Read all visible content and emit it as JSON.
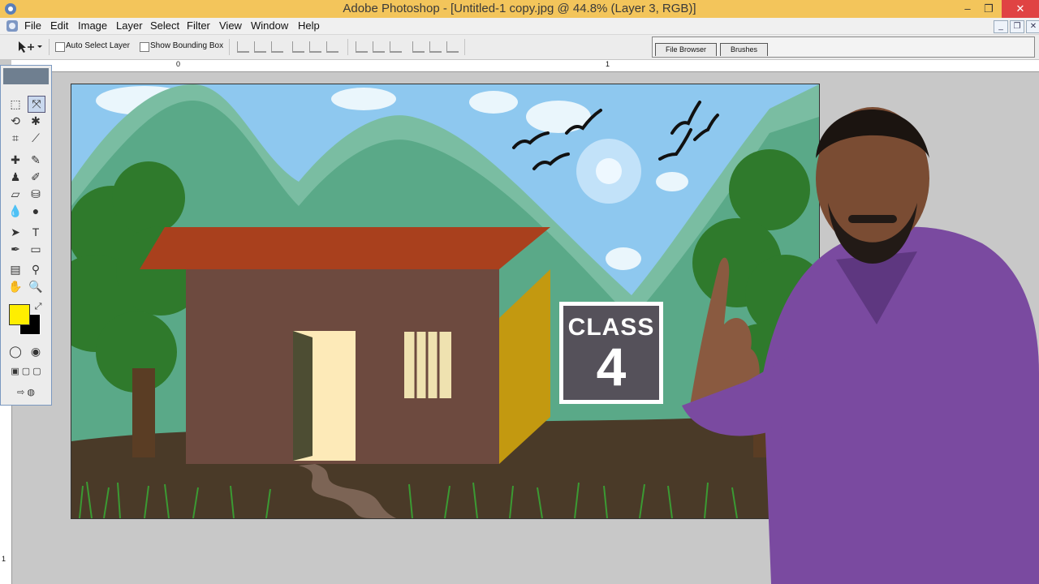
{
  "window": {
    "title": "Adobe Photoshop - [Untitled-1 copy.jpg @ 44.8% (Layer 3, RGB)]",
    "minimize": "–",
    "restore": "❐",
    "close": "✕"
  },
  "menu": [
    "File",
    "Edit",
    "Image",
    "Layer",
    "Select",
    "Filter",
    "View",
    "Window",
    "Help"
  ],
  "options": {
    "auto_select_label": "Auto Select Layer",
    "bounding_box_label": "Show Bounding Box"
  },
  "palette_tabs": [
    "File Browser",
    "Brushes"
  ],
  "rulers": {
    "top": [
      "0",
      "1"
    ],
    "left": [
      "1"
    ]
  },
  "thumbnail": {
    "badge_word": "CLASS",
    "badge_number": "4"
  },
  "colors": {
    "foreground": "#ffee00",
    "background": "#000000",
    "title_bar": "#f3c55b",
    "close_button": "#e04343"
  },
  "icons": [
    "photoshop-logo-icon",
    "move-tool-icon",
    "marquee-icon",
    "lasso-icon",
    "magic-wand-icon",
    "crop-icon",
    "slice-icon",
    "healing-icon",
    "brush-icon",
    "stamp-icon",
    "history-brush-icon",
    "eraser-icon",
    "bucket-icon",
    "blur-icon",
    "dodge-icon",
    "path-select-icon",
    "type-icon",
    "pen-icon",
    "shape-icon",
    "notes-icon",
    "eyedropper-icon",
    "hand-icon",
    "zoom-icon"
  ]
}
